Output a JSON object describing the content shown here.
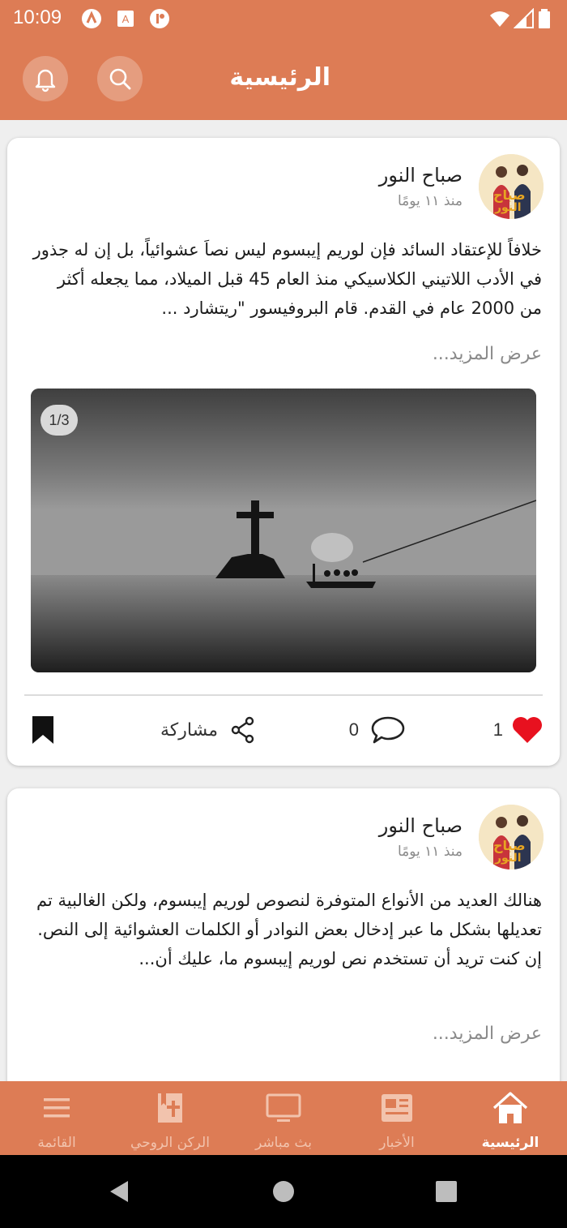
{
  "status_bar": {
    "time": "10:09"
  },
  "header": {
    "title": "الرئيسية",
    "search_icon": "search-icon",
    "bell_icon": "bell-icon"
  },
  "posts": [
    {
      "author": "صباح النور",
      "time_ago": "منذ ١١ يومًا",
      "text": "خلافاً للإعتقاد السائد فإن لوريم إيبسوم ليس نصاَ عشوائياً، بل إن له جذور في الأدب اللاتيني الكلاسيكي منذ العام 45 قبل الميلاد، مما يجعله أكثر من 2000 عام في القدم. قام البروفيسور \"ريتشارد ...",
      "read_more": "عرض المزيد...",
      "image_counter": "1/3",
      "likes": "1",
      "comments": "0",
      "share_label": "مشاركة"
    },
    {
      "author": "صباح النور",
      "time_ago": "منذ ١١ يومًا",
      "text": "هنالك العديد من الأنواع المتوفرة لنصوص لوريم إيبسوم، ولكن الغالبية تم تعديلها بشكل ما عبر إدخال بعض النوادر أو الكلمات العشوائية إلى النص. إن كنت تريد أن تستخدم نص لوريم إيبسوم ما، عليك أن...",
      "read_more": "عرض المزيد..."
    }
  ],
  "bottom_nav": [
    {
      "label": "الرئيسية",
      "icon": "home-icon",
      "active": true
    },
    {
      "label": "الأخبار",
      "icon": "news-icon",
      "active": false
    },
    {
      "label": "بث مباشر",
      "icon": "tv-icon",
      "active": false
    },
    {
      "label": "الركن الروحي",
      "icon": "bible-icon",
      "active": false
    },
    {
      "label": "القائمة",
      "icon": "menu-icon",
      "active": false
    }
  ],
  "colors": {
    "primary": "#dd7c55",
    "like": "#e8111f",
    "bookmark": "#111111"
  }
}
